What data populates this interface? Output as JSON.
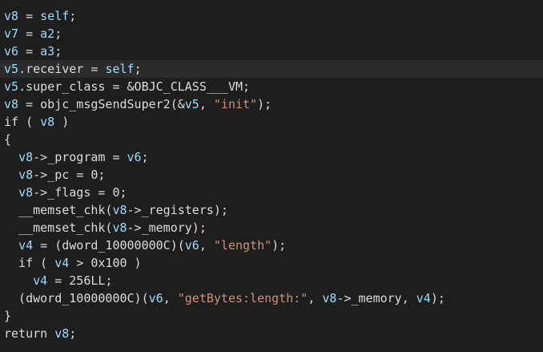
{
  "editor": {
    "active_line": 3,
    "lines": [
      [
        {
          "t": "v8",
          "c": "var"
        },
        {
          "t": " = ",
          "c": "plain"
        },
        {
          "t": "self",
          "c": "var"
        },
        {
          "t": ";",
          "c": "plain"
        }
      ],
      [
        {
          "t": "v7",
          "c": "var"
        },
        {
          "t": " = ",
          "c": "plain"
        },
        {
          "t": "a2",
          "c": "var"
        },
        {
          "t": ";",
          "c": "plain"
        }
      ],
      [
        {
          "t": "v6",
          "c": "var"
        },
        {
          "t": " = ",
          "c": "plain"
        },
        {
          "t": "a3",
          "c": "var"
        },
        {
          "t": ";",
          "c": "plain"
        }
      ],
      [
        {
          "t": "v5",
          "c": "var"
        },
        {
          "t": ".receiver = ",
          "c": "plain"
        },
        {
          "t": "self",
          "c": "var"
        },
        {
          "t": ";",
          "c": "plain"
        }
      ],
      [
        {
          "t": "v5",
          "c": "var"
        },
        {
          "t": ".super_class = &OBJC_CLASS___VM;",
          "c": "plain"
        }
      ],
      [
        {
          "t": "v8",
          "c": "var"
        },
        {
          "t": " = objc_msgSendSuper2(&",
          "c": "plain"
        },
        {
          "t": "v5",
          "c": "var"
        },
        {
          "t": ", ",
          "c": "plain"
        },
        {
          "t": "\"init\"",
          "c": "str"
        },
        {
          "t": ");",
          "c": "plain"
        }
      ],
      [
        {
          "t": "if ( ",
          "c": "plain"
        },
        {
          "t": "v8",
          "c": "var"
        },
        {
          "t": " )",
          "c": "plain"
        }
      ],
      [
        {
          "t": "{",
          "c": "plain"
        }
      ],
      [
        {
          "t": "  ",
          "c": "plain"
        },
        {
          "t": "v8",
          "c": "var"
        },
        {
          "t": "->_program = ",
          "c": "plain"
        },
        {
          "t": "v6",
          "c": "var"
        },
        {
          "t": ";",
          "c": "plain"
        }
      ],
      [
        {
          "t": "  ",
          "c": "plain"
        },
        {
          "t": "v8",
          "c": "var"
        },
        {
          "t": "->_pc = 0;",
          "c": "plain"
        }
      ],
      [
        {
          "t": "  ",
          "c": "plain"
        },
        {
          "t": "v8",
          "c": "var"
        },
        {
          "t": "->_flags = 0;",
          "c": "plain"
        }
      ],
      [
        {
          "t": "  __memset_chk(",
          "c": "plain"
        },
        {
          "t": "v8",
          "c": "var"
        },
        {
          "t": "->_registers);",
          "c": "plain"
        }
      ],
      [
        {
          "t": "  __memset_chk(",
          "c": "plain"
        },
        {
          "t": "v8",
          "c": "var"
        },
        {
          "t": "->_memory);",
          "c": "plain"
        }
      ],
      [
        {
          "t": "  ",
          "c": "plain"
        },
        {
          "t": "v4",
          "c": "var"
        },
        {
          "t": " = (dword_10000000C)(",
          "c": "plain"
        },
        {
          "t": "v6",
          "c": "var"
        },
        {
          "t": ", ",
          "c": "plain"
        },
        {
          "t": "\"length\"",
          "c": "str"
        },
        {
          "t": ");",
          "c": "plain"
        }
      ],
      [
        {
          "t": "  if ( ",
          "c": "plain"
        },
        {
          "t": "v4",
          "c": "var"
        },
        {
          "t": " > 0x100 )",
          "c": "plain"
        }
      ],
      [
        {
          "t": "    ",
          "c": "plain"
        },
        {
          "t": "v4",
          "c": "var"
        },
        {
          "t": " = 256LL;",
          "c": "plain"
        }
      ],
      [
        {
          "t": "  (dword_10000000C)(",
          "c": "plain"
        },
        {
          "t": "v6",
          "c": "var"
        },
        {
          "t": ", ",
          "c": "plain"
        },
        {
          "t": "\"getBytes:length:\"",
          "c": "str"
        },
        {
          "t": ", ",
          "c": "plain"
        },
        {
          "t": "v8",
          "c": "var"
        },
        {
          "t": "->_memory, ",
          "c": "plain"
        },
        {
          "t": "v4",
          "c": "var"
        },
        {
          "t": ");",
          "c": "plain"
        }
      ],
      [
        {
          "t": "}",
          "c": "plain"
        }
      ],
      [
        {
          "t": "return ",
          "c": "plain"
        },
        {
          "t": "v8",
          "c": "var"
        },
        {
          "t": ";",
          "c": "plain"
        }
      ]
    ]
  },
  "colors": {
    "background": "#1e1e1e",
    "active_line": "#2b2b2b",
    "variable": "#9cdcfe",
    "string": "#ce9178",
    "plain": "#dcdcdc"
  }
}
